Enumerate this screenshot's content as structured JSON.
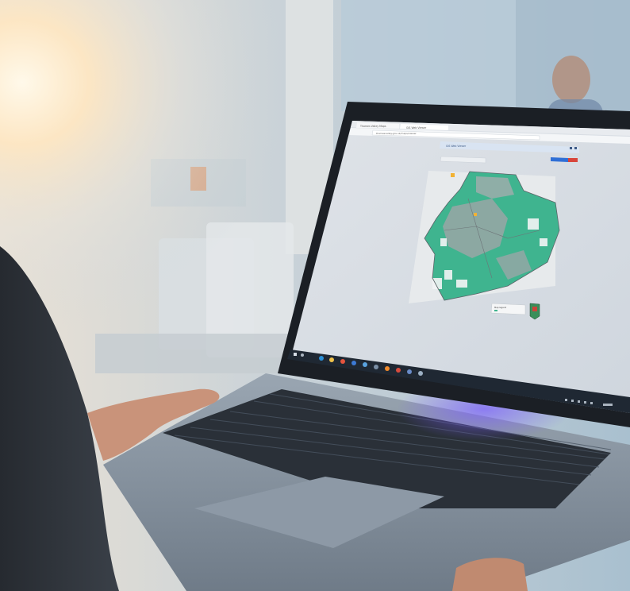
{
  "scene": {
    "description_free": true
  },
  "browser": {
    "tabs": [
      {
        "label": "Thames Valley Maps"
      },
      {
        "label": "GIS Web Viewer"
      }
    ],
    "address": "thamesvalley.gov.uk/maps/viewer"
  },
  "map_app": {
    "header_label": "GIS Web Viewer",
    "search_placeholder": "",
    "legend_label": "Map legend",
    "legend_sub": "",
    "colors": {
      "land_green": "#3fb48f",
      "urban": "#9aa6a6",
      "boundary": "#5b6468",
      "header_bar": "#4f86c6",
      "red_button": "#d8453b",
      "blue_button": "#2f6fd6"
    }
  },
  "taskbar": {
    "icons": [
      "windows-icon",
      "search-icon",
      "task-view-icon",
      "edge-icon",
      "explorer-icon",
      "chrome-icon",
      "mail-icon",
      "store-icon",
      "photos-icon",
      "spotify-icon",
      "settings-icon",
      "teams-icon"
    ]
  }
}
